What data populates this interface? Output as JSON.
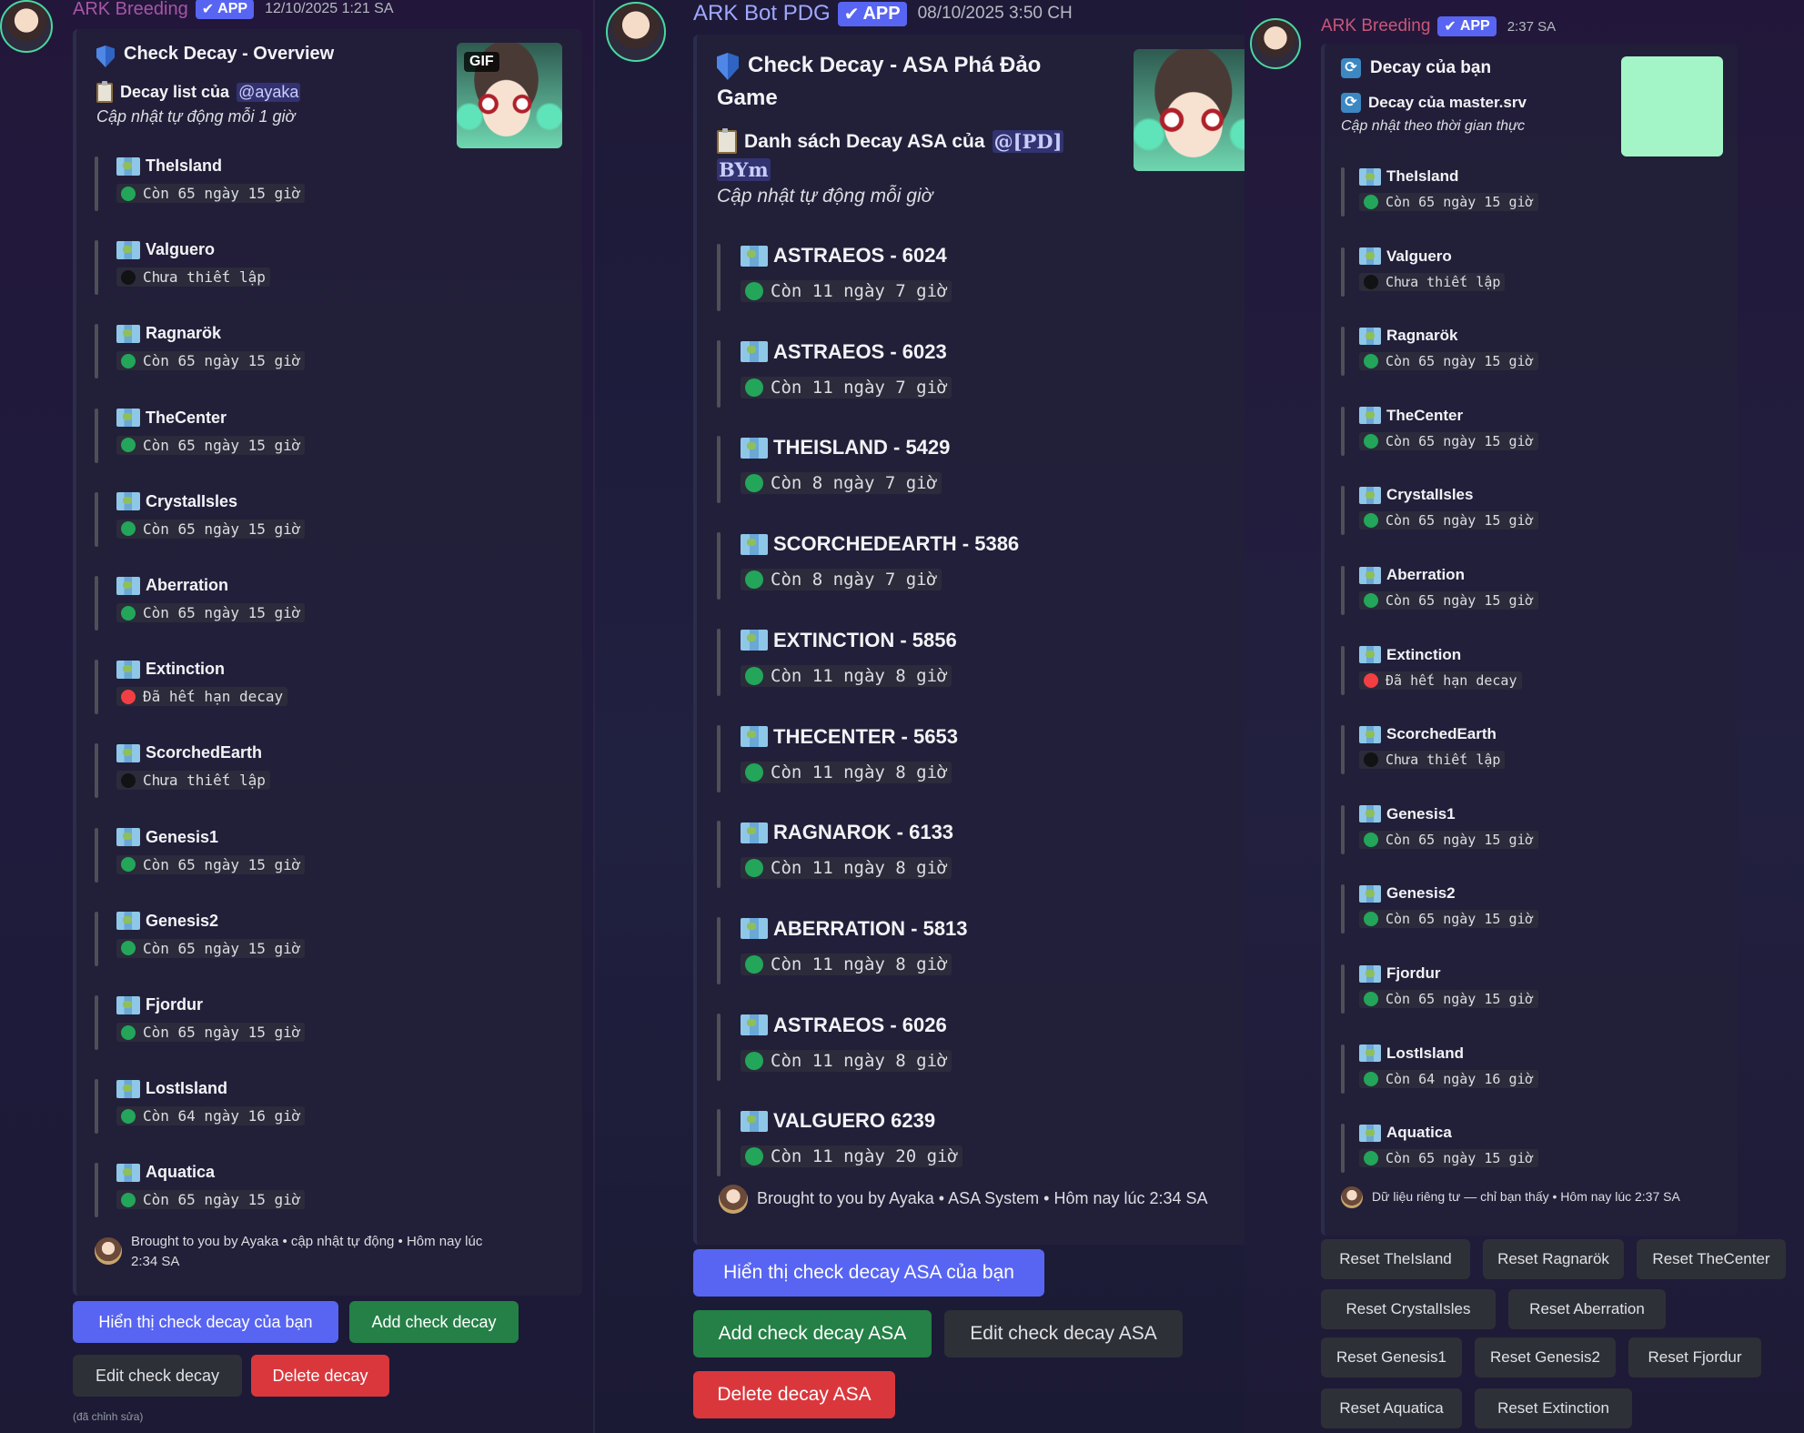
{
  "col1": {
    "bot_name": "ARK Breeding",
    "app_badge": "APP",
    "timestamp": "12/10/2025 1:21 SA",
    "title": "Check Decay - Overview",
    "desc_prefix": "Decay list của",
    "mention": "@ayaka",
    "subtitle": "Cập nhật tự động mỗi 1 giờ",
    "gif_label": "GIF",
    "fields": [
      {
        "name": "TheIsland",
        "value": "Còn 65 ngày 15 giờ",
        "status": "green"
      },
      {
        "name": "Valguero",
        "value": "Chưa thiết lập",
        "status": "black"
      },
      {
        "name": "Ragnarök",
        "value": "Còn 65 ngày 15 giờ",
        "status": "green"
      },
      {
        "name": "TheCenter",
        "value": "Còn 65 ngày 15 giờ",
        "status": "green"
      },
      {
        "name": "CrystalIsles",
        "value": "Còn 65 ngày 15 giờ",
        "status": "green"
      },
      {
        "name": "Aberration",
        "value": "Còn 65 ngày 15 giờ",
        "status": "green"
      },
      {
        "name": "Extinction",
        "value": "Đã hết hạn decay",
        "status": "red"
      },
      {
        "name": "ScorchedEarth",
        "value": "Chưa thiết lập",
        "status": "black"
      },
      {
        "name": "Genesis1",
        "value": "Còn 65 ngày 15 giờ",
        "status": "green"
      },
      {
        "name": "Genesis2",
        "value": "Còn 65 ngày 15 giờ",
        "status": "green"
      },
      {
        "name": "Fjordur",
        "value": "Còn 65 ngày 15 giờ",
        "status": "green"
      },
      {
        "name": "LostIsland",
        "value": "Còn 64 ngày 16 giờ",
        "status": "green"
      },
      {
        "name": "Aquatica",
        "value": "Còn 65 ngày 15 giờ",
        "status": "green"
      }
    ],
    "footer_line1": "Brought to you by Ayaka • cập nhật tự động • Hôm nay lúc",
    "footer_line2": "2:34 SA",
    "buttons": {
      "show": "Hiển thị check decay của bạn",
      "add": "Add check decay",
      "edit": "Edit check decay",
      "delete": "Delete decay"
    },
    "edited": "(đã chỉnh sửa)"
  },
  "col2": {
    "bot_name": "ARK Bot PDG",
    "app_badge": "APP",
    "timestamp": "08/10/2025 3:50 CH",
    "title_line1": "Check Decay - ASA Phá Đảo",
    "title_line2": "Game",
    "desc_prefix": "Danh sách Decay ASA của",
    "mention_line1": "@[PD]",
    "mention_line2": "BYm",
    "subtitle": "Cập nhật tự động mỗi giờ",
    "fields": [
      {
        "name": "ASTRAEOS - 6024",
        "value": "Còn 11 ngày 7 giờ",
        "status": "green"
      },
      {
        "name": "ASTRAEOS - 6023",
        "value": "Còn 11 ngày 7 giờ",
        "status": "green"
      },
      {
        "name": "THEISLAND - 5429",
        "value": "Còn 8 ngày 7 giờ",
        "status": "green"
      },
      {
        "name": "SCORCHEDEARTH - 5386",
        "value": "Còn 8 ngày 7 giờ",
        "status": "green"
      },
      {
        "name": "EXTINCTION - 5856",
        "value": "Còn 11 ngày 8 giờ",
        "status": "green"
      },
      {
        "name": "THECENTER - 5653",
        "value": "Còn 11 ngày 8 giờ",
        "status": "green"
      },
      {
        "name": "RAGNAROK - 6133",
        "value": "Còn 11 ngày 8 giờ",
        "status": "green"
      },
      {
        "name": "ABERRATION - 5813",
        "value": "Còn 11 ngày 8 giờ",
        "status": "green"
      },
      {
        "name": "ASTRAEOS - 6026",
        "value": "Còn 11 ngày 8 giờ",
        "status": "green"
      },
      {
        "name": "VALGUERO 6239",
        "value": "Còn 11 ngày 20 giờ",
        "status": "green"
      }
    ],
    "footer": "Brought to you by Ayaka • ASA System • Hôm nay lúc 2:34 SA",
    "buttons": {
      "show": "Hiển thị check decay ASA của bạn",
      "add": "Add check decay ASA",
      "edit": "Edit check decay ASA",
      "delete": "Delete decay ASA"
    }
  },
  "col3": {
    "bot_name": "ARK Breeding",
    "app_badge": "APP",
    "timestamp": "2:37 SA",
    "title": "Decay của bạn",
    "desc": "Decay của master.srv",
    "subtitle": "Cập nhật theo thời gian thực",
    "fields": [
      {
        "name": "TheIsland",
        "value": "Còn 65 ngày 15 giờ",
        "status": "green"
      },
      {
        "name": "Valguero",
        "value": "Chưa thiết lập",
        "status": "black"
      },
      {
        "name": "Ragnarök",
        "value": "Còn 65 ngày 15 giờ",
        "status": "green"
      },
      {
        "name": "TheCenter",
        "value": "Còn 65 ngày 15 giờ",
        "status": "green"
      },
      {
        "name": "CrystalIsles",
        "value": "Còn 65 ngày 15 giờ",
        "status": "green"
      },
      {
        "name": "Aberration",
        "value": "Còn 65 ngày 15 giờ",
        "status": "green"
      },
      {
        "name": "Extinction",
        "value": "Đã hết hạn decay",
        "status": "red"
      },
      {
        "name": "ScorchedEarth",
        "value": "Chưa thiết lập",
        "status": "black"
      },
      {
        "name": "Genesis1",
        "value": "Còn 65 ngày 15 giờ",
        "status": "green"
      },
      {
        "name": "Genesis2",
        "value": "Còn 65 ngày 15 giờ",
        "status": "green"
      },
      {
        "name": "Fjordur",
        "value": "Còn 65 ngày 15 giờ",
        "status": "green"
      },
      {
        "name": "LostIsland",
        "value": "Còn 64 ngày 16 giờ",
        "status": "green"
      },
      {
        "name": "Aquatica",
        "value": "Còn 65 ngày 15 giờ",
        "status": "green"
      }
    ],
    "footer": "Dữ liệu riêng tư — chỉ bạn thấy • Hôm nay lúc 2:37 SA",
    "reset_buttons": [
      [
        "Reset TheIsland",
        "Reset Ragnarök",
        "Reset TheCenter"
      ],
      [
        "Reset CrystalIsles",
        "Reset Aberration"
      ],
      [
        "Reset Genesis1",
        "Reset Genesis2",
        "Reset Fjordur"
      ],
      [
        "Reset Aquatica",
        "Reset Extinction"
      ]
    ]
  },
  "colors": {
    "green": "#23a55a",
    "red": "#f23f43",
    "black": "#111214",
    "blurple": "#5865f2",
    "success": "#248046",
    "danger": "#da373c",
    "secondary": "#2e3037",
    "bot_name_pink": "#a855a8",
    "thumb_mint": "#a3f5c8"
  }
}
